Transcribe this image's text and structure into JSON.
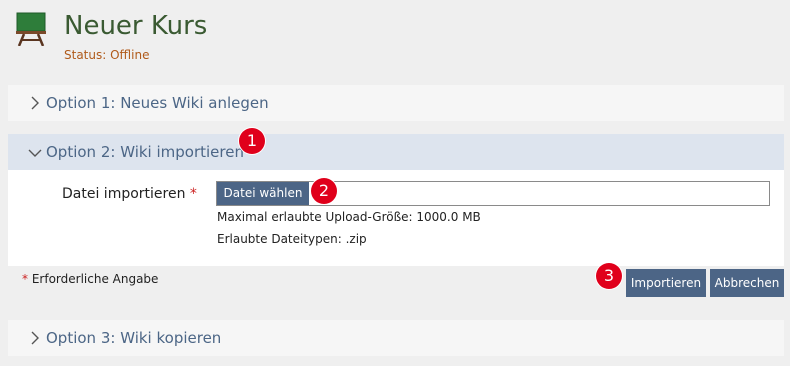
{
  "header": {
    "title": "Neuer Kurs",
    "status": "Status: Offline"
  },
  "accordion": [
    {
      "label": "Option 1: Neues Wiki anlegen",
      "expanded": false
    },
    {
      "label": "Option 2: Wiki importieren",
      "expanded": true
    },
    {
      "label": "Option 3: Wiki kopieren",
      "expanded": false
    }
  ],
  "form": {
    "field_label": "Datei importieren",
    "required_marker": "*",
    "file_button": "Datei wählen",
    "max_upload": "Maximal erlaubte Upload-Größe: 1000.0 MB",
    "allowed_types": "Erlaubte Dateitypen: .zip",
    "required_note_marker": "*",
    "required_note": "Erforderliche Angabe",
    "import_button": "Importieren",
    "cancel_button": "Abbrechen"
  },
  "badges": [
    "1",
    "2",
    "3"
  ],
  "colors": {
    "title": "#3a5a32",
    "status": "#b05a1a",
    "accent": "#4c6586",
    "badge": "#e0001b"
  },
  "icons": {
    "course": "chalkboard-icon",
    "collapsed": "chevron-right-icon",
    "expanded": "chevron-down-icon"
  }
}
